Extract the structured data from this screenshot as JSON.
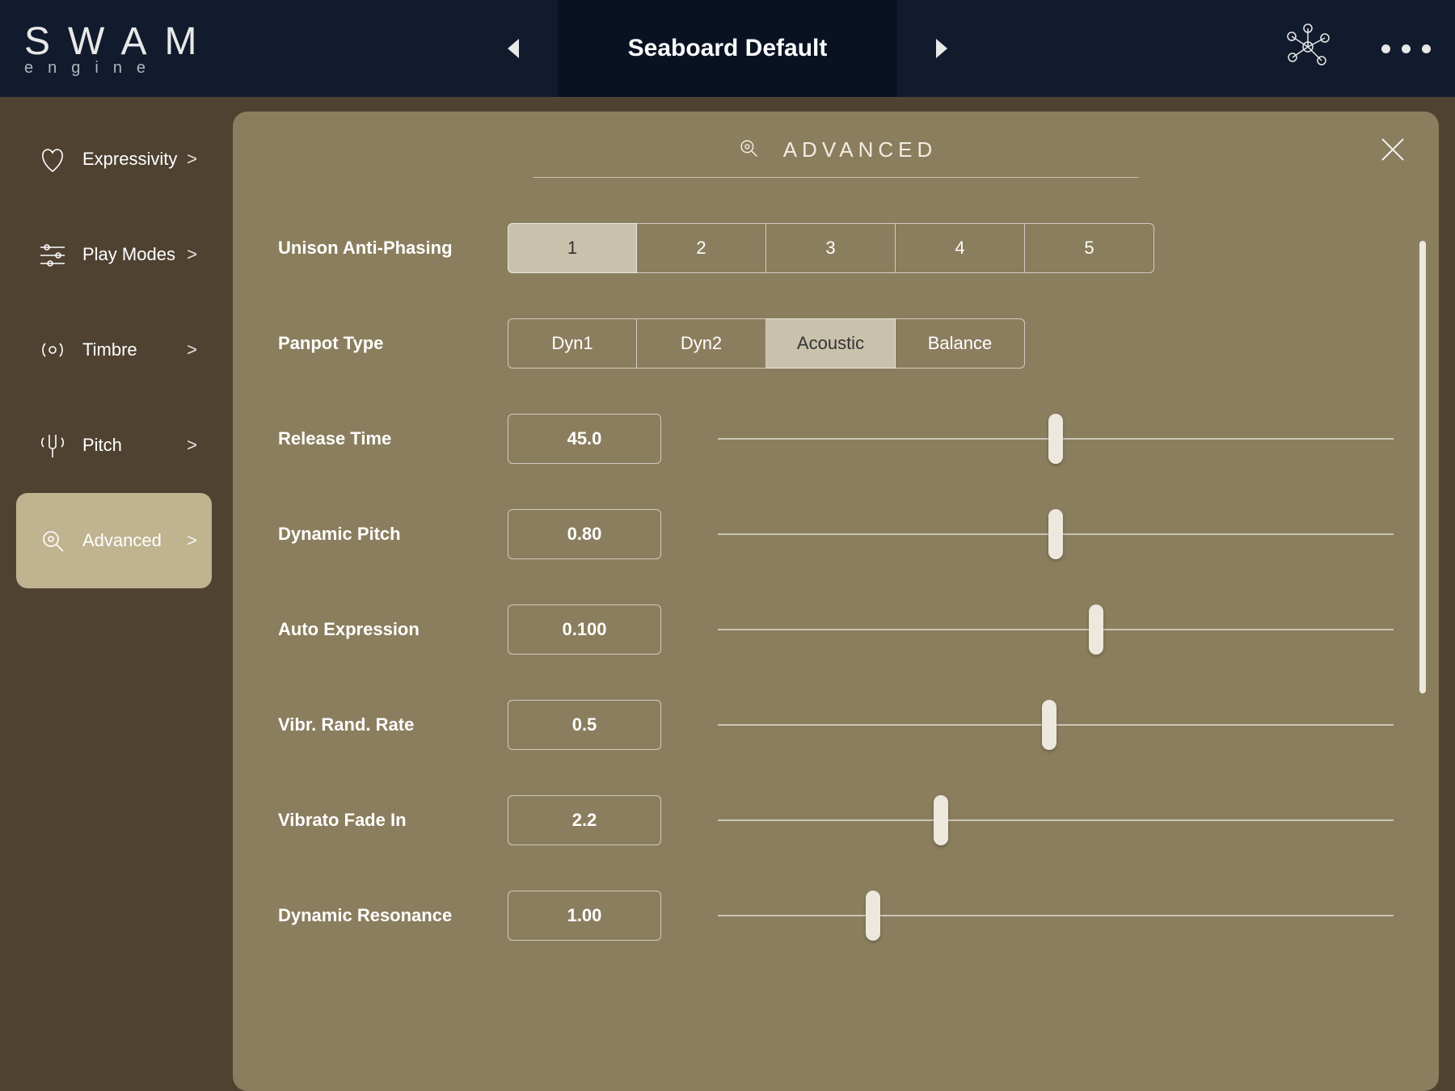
{
  "logo": {
    "top": "SWAM",
    "bottom": "engine"
  },
  "header": {
    "preset_title": "Seaboard Default"
  },
  "sidebar": {
    "items": [
      {
        "label": "Expressivity",
        "active": false
      },
      {
        "label": "Play Modes",
        "active": false
      },
      {
        "label": "Timbre",
        "active": false
      },
      {
        "label": "Pitch",
        "active": false
      },
      {
        "label": "Advanced",
        "active": true
      }
    ]
  },
  "panel": {
    "title": "ADVANCED",
    "unison": {
      "label": "Unison Anti-Phasing",
      "options": [
        "1",
        "2",
        "3",
        "4",
        "5"
      ],
      "active": 0
    },
    "panpot": {
      "label": "Panpot Type",
      "options": [
        "Dyn1",
        "Dyn2",
        "Acoustic",
        "Balance"
      ],
      "active": 2
    },
    "params": [
      {
        "label": "Release Time",
        "value": "45.0",
        "pos": 50
      },
      {
        "label": "Dynamic Pitch",
        "value": "0.80",
        "pos": 50
      },
      {
        "label": "Auto Expression",
        "value": "0.100",
        "pos": 56
      },
      {
        "label": "Vibr. Rand. Rate",
        "value": "0.5",
        "pos": 49
      },
      {
        "label": "Vibrato Fade In",
        "value": "2.2",
        "pos": 33
      },
      {
        "label": "Dynamic Resonance",
        "value": "1.00",
        "pos": 23
      }
    ]
  }
}
